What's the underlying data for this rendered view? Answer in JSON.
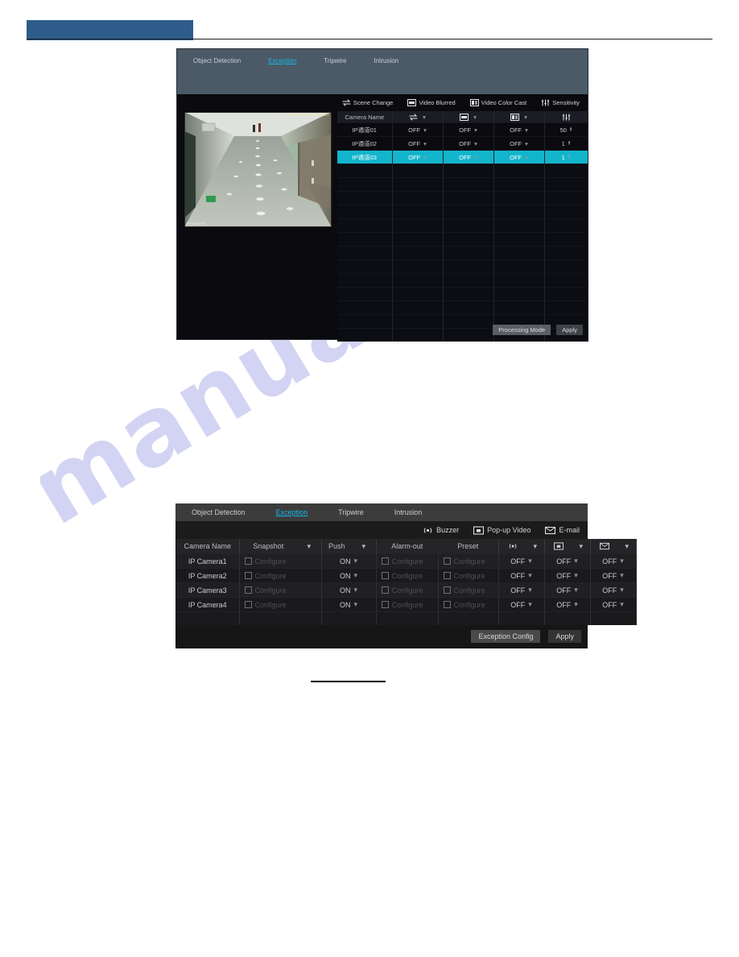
{
  "watermark": {
    "text": "manualshive.com"
  },
  "panel_top": {
    "tabs": [
      {
        "label": "Object Detection",
        "active": false
      },
      {
        "label": "Exception",
        "active": true
      },
      {
        "label": "Tripwire",
        "active": false
      },
      {
        "label": "Intrusion",
        "active": false
      }
    ],
    "legend": [
      {
        "label": "Scene Change",
        "icon": "scene-change-icon"
      },
      {
        "label": "Video Blurred",
        "icon": "video-blurred-icon"
      },
      {
        "label": "Video Color Cast",
        "icon": "video-color-cast-icon"
      },
      {
        "label": "Sensitivity",
        "icon": "sensitivity-icon"
      }
    ],
    "preview": {
      "timestamp": "05/05/2018 15:20:17",
      "camera_label": "IP Camera1"
    },
    "table": {
      "headers": [
        {
          "label": "Camera Name",
          "icon": ""
        },
        {
          "label": "",
          "icon": "scene-change-icon"
        },
        {
          "label": "",
          "icon": "video-blurred-icon"
        },
        {
          "label": "",
          "icon": "video-color-cast-icon"
        },
        {
          "label": "",
          "icon": "sensitivity-icon"
        }
      ],
      "rows": [
        {
          "camera": "IP通道01",
          "scene_change": "OFF",
          "video_blurred": "OFF",
          "color_cast": "OFF",
          "sensitivity": "50",
          "selected": false
        },
        {
          "camera": "IP通道02",
          "scene_change": "OFF",
          "video_blurred": "OFF",
          "color_cast": "OFF",
          "sensitivity": "1",
          "selected": false
        },
        {
          "camera": "IP通道03",
          "scene_change": "OFF",
          "video_blurred": "OFF",
          "color_cast": "OFF",
          "sensitivity": "1",
          "selected": true
        }
      ]
    },
    "buttons": {
      "processing_mode": "Processing Mode",
      "apply": "Apply"
    }
  },
  "panel_bottom": {
    "tabs": [
      {
        "label": "Object Detection",
        "active": false
      },
      {
        "label": "Exception",
        "active": true
      },
      {
        "label": "Tripwire",
        "active": false
      },
      {
        "label": "Intrusion",
        "active": false
      }
    ],
    "legend": [
      {
        "label": "Buzzer",
        "icon": "buzzer-icon"
      },
      {
        "label": "Pop-up Video",
        "icon": "popup-video-icon"
      },
      {
        "label": "E-mail",
        "icon": "email-icon"
      }
    ],
    "table": {
      "headers": [
        {
          "label": "Camera Name",
          "icon": ""
        },
        {
          "label": "Snapshot",
          "icon": ""
        },
        {
          "label": "Push",
          "icon": ""
        },
        {
          "label": "Alarm-out",
          "icon": ""
        },
        {
          "label": "Preset",
          "icon": ""
        },
        {
          "label": "",
          "icon": "buzzer-icon"
        },
        {
          "label": "",
          "icon": "popup-video-icon"
        },
        {
          "label": "",
          "icon": "email-icon"
        }
      ],
      "configure_label": "Configure",
      "rows": [
        {
          "camera": "IP Camera1",
          "snapshot": "Configure",
          "push": "ON",
          "alarm_out": "Configure",
          "preset": "Configure",
          "buzzer": "OFF",
          "popup_video": "OFF",
          "email": "OFF"
        },
        {
          "camera": "IP Camera2",
          "snapshot": "Configure",
          "push": "ON",
          "alarm_out": "Configure",
          "preset": "Configure",
          "buzzer": "OFF",
          "popup_video": "OFF",
          "email": "OFF"
        },
        {
          "camera": "IP Camera3",
          "snapshot": "Configure",
          "push": "ON",
          "alarm_out": "Configure",
          "preset": "Configure",
          "buzzer": "OFF",
          "popup_video": "OFF",
          "email": "OFF"
        },
        {
          "camera": "IP Camera4",
          "snapshot": "Configure",
          "push": "ON",
          "alarm_out": "Configure",
          "preset": "Configure",
          "buzzer": "OFF",
          "popup_video": "OFF",
          "email": "OFF"
        }
      ]
    },
    "buttons": {
      "exception_config": "Exception Config",
      "apply": "Apply"
    }
  },
  "colors": {
    "accent_cyan": "#19b6e6",
    "row_selected": "#12b5cc",
    "header_block": "#2e5c8a",
    "panel_top_tabbar": "#4b5a66",
    "panel_bottom_tabbar": "#3c3c3c"
  }
}
